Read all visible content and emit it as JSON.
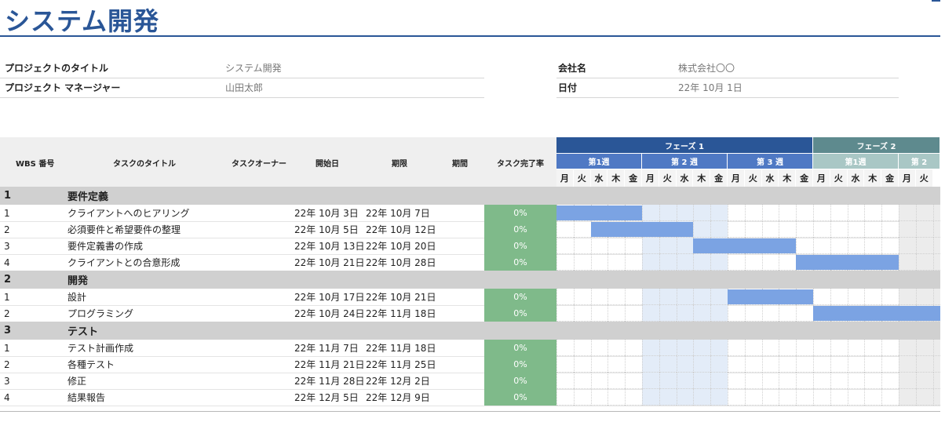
{
  "title": "システム開発",
  "info": {
    "project_title_label": "プロジェクトのタイトル",
    "project_title_value": "システム開発",
    "manager_label": "プロジェクト マネージャー",
    "manager_value": "山田太郎",
    "company_label": "会社名",
    "company_value": "株式会社〇〇",
    "date_label": "日付",
    "date_value": "22年 10月 1日"
  },
  "columns": {
    "wbs": "WBS 番号",
    "task": "タスクのタイトル",
    "owner": "タスクオーナー",
    "start": "開始日",
    "due": "期限",
    "duration": "期間",
    "progress": "タスク完了率"
  },
  "phases": [
    {
      "label": "フェーズ 1",
      "color": "#2a5697"
    },
    {
      "label": "フェーズ 2",
      "color": "#5e8a8e"
    }
  ],
  "weeks": [
    {
      "label": "第1週",
      "color": "#4f79c4"
    },
    {
      "label": "第 2 週",
      "color": "#4f79c4"
    },
    {
      "label": "第 3 週",
      "color": "#4f79c4"
    },
    {
      "label": "第1週",
      "color": "#a9c7c5"
    },
    {
      "label": "第 2",
      "color": "#a9c7c5"
    }
  ],
  "weekdays": [
    "月",
    "火",
    "水",
    "木",
    "金",
    "月",
    "火",
    "水",
    "木",
    "金",
    "月",
    "火",
    "水",
    "木",
    "金",
    "月",
    "火",
    "水",
    "木",
    "金",
    "月",
    "火"
  ],
  "rows": [
    {
      "type": "phase",
      "wbs": "1",
      "title": "要件定義"
    },
    {
      "type": "task",
      "wbs": "1",
      "title": "クライアントへのヒアリング",
      "owner": "",
      "start": "22年 10月 3日",
      "due": "22年 10月 7日",
      "duration": "",
      "progress": "0%",
      "bar_start": 0,
      "bar_days": 5
    },
    {
      "type": "task",
      "wbs": "2",
      "title": "必須要件と希望要件の整理",
      "owner": "",
      "start": "22年 10月 5日",
      "due": "22年 10月 12日",
      "duration": "",
      "progress": "0%",
      "bar_start": 2,
      "bar_days": 6
    },
    {
      "type": "task",
      "wbs": "3",
      "title": "要件定義書の作成",
      "owner": "",
      "start": "22年 10月 13日",
      "due": "22年 10月 20日",
      "duration": "",
      "progress": "0%",
      "bar_start": 8,
      "bar_days": 6
    },
    {
      "type": "task",
      "wbs": "4",
      "title": "クライアントとの合意形成",
      "owner": "",
      "start": "22年 10月 21日",
      "due": "22年 10月 28日",
      "duration": "",
      "progress": "0%",
      "bar_start": 14,
      "bar_days": 6
    },
    {
      "type": "phase",
      "wbs": "2",
      "title": "開発"
    },
    {
      "type": "task",
      "wbs": "1",
      "title": "設計",
      "owner": "",
      "start": "22年 10月 17日",
      "due": "22年 10月 21日",
      "duration": "",
      "progress": "0%",
      "bar_start": 10,
      "bar_days": 5
    },
    {
      "type": "task",
      "wbs": "2",
      "title": "プログラミング",
      "owner": "",
      "start": "22年 10月 24日",
      "due": "22年 11月 18日",
      "duration": "",
      "progress": "0%",
      "bar_start": 15,
      "bar_days": 20
    },
    {
      "type": "phase",
      "wbs": "3",
      "title": "テスト"
    },
    {
      "type": "task",
      "wbs": "1",
      "title": "テスト計画作成",
      "owner": "",
      "start": "22年 11月 7日",
      "due": "22年 11月 18日",
      "duration": "",
      "progress": "0%",
      "bar_start": 25,
      "bar_days": 10
    },
    {
      "type": "task",
      "wbs": "2",
      "title": "各種テスト",
      "owner": "",
      "start": "22年 11月 21日",
      "due": "22年 11月 25日",
      "duration": "",
      "progress": "0%",
      "bar_start": 35,
      "bar_days": 5
    },
    {
      "type": "task",
      "wbs": "3",
      "title": "修正",
      "owner": "",
      "start": "22年 11月 28日",
      "due": "22年 12月 2日",
      "duration": "",
      "progress": "0%",
      "bar_start": 40,
      "bar_days": 5
    },
    {
      "type": "task",
      "wbs": "4",
      "title": "結果報告",
      "owner": "",
      "start": "22年 12月 5日",
      "due": "22年 12月 9日",
      "duration": "",
      "progress": "0%",
      "bar_start": 45,
      "bar_days": 5
    }
  ],
  "colors": {
    "bar": "#7ba3e3",
    "week2_fill": "#e3ecf8",
    "week5_fill": "#ececec",
    "progress_fill": "#7fba8a",
    "phase_row": "#d0d0d0"
  }
}
